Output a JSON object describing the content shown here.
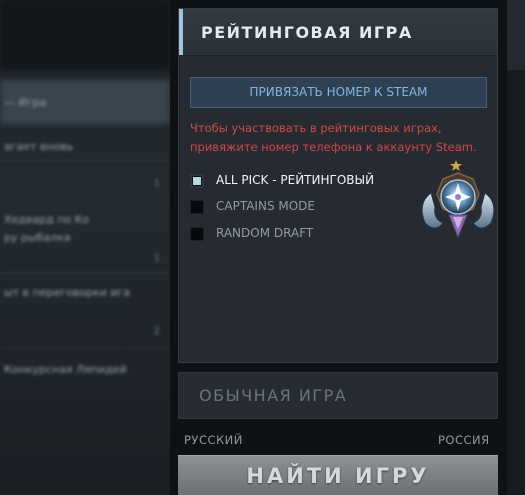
{
  "ranked": {
    "title": "РЕЙТИНГОВАЯ ИГРА",
    "link_button": "ПРИВЯЗАТЬ НОМЕР К STEAM",
    "warning_line1": "Чтобы участвовать в рейтинговых играх,",
    "warning_line2": "привяжите номер телефона к аккаунту Steam.",
    "modes": [
      {
        "label": "ALL PICK - РЕЙТИНГОВЫЙ",
        "checked": true
      },
      {
        "label": "CAPTAINS MODE",
        "checked": false
      },
      {
        "label": "RANDOM DRAFT",
        "checked": false
      }
    ],
    "medal_icon": "rank-medal-icon"
  },
  "normal": {
    "label": "ОБЫЧНАЯ ИГРА"
  },
  "region": {
    "language": "РУССКИЙ",
    "server": "РОССИЯ"
  },
  "find_button": {
    "label": "НАЙТИ ИГРУ"
  },
  "background_list": [
    {
      "text": "— Игра",
      "num": ""
    },
    {
      "text": "агает вновь",
      "num": ""
    },
    {
      "text": "",
      "num": "1"
    },
    {
      "text": "Хедвард по Ко",
      "num": ""
    },
    {
      "text": "ру рыбалка",
      "num": ""
    },
    {
      "text": "",
      "num": "1"
    },
    {
      "text": "ыт в переговорки ига",
      "num": ""
    },
    {
      "text": "",
      "num": "2"
    },
    {
      "text": "Конкурсная Ляпидей",
      "num": ""
    }
  ],
  "colors": {
    "accent": "#9fc6d8",
    "warning": "#d0494a",
    "link": "#7fb6e2"
  }
}
